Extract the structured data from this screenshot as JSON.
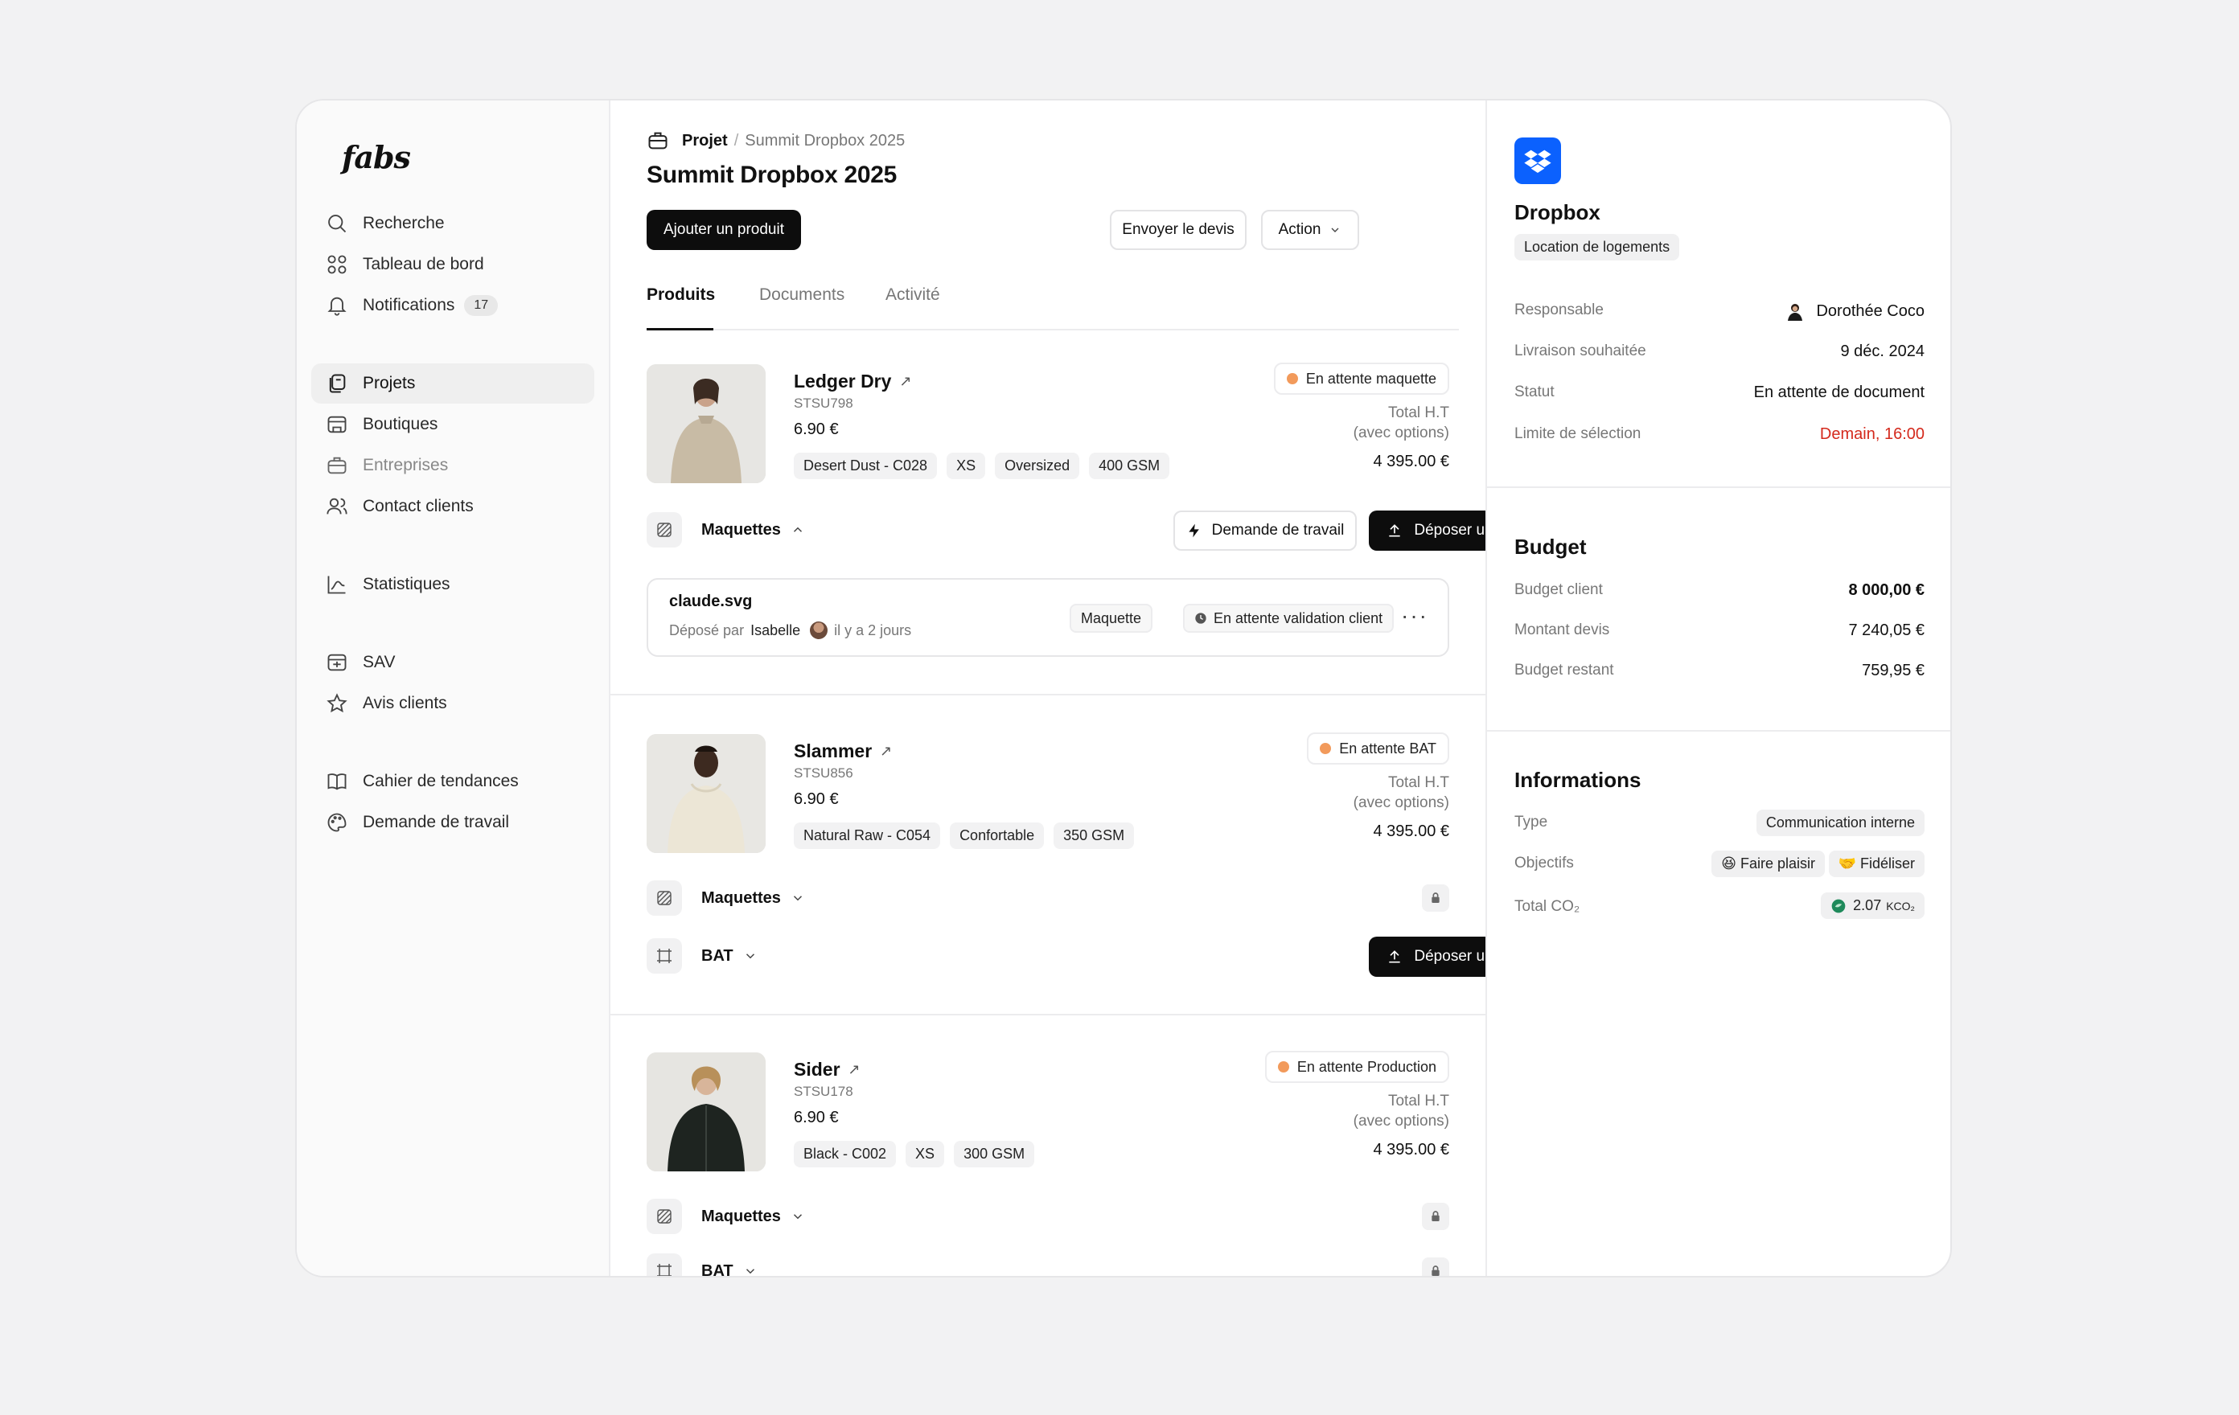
{
  "app": {
    "logo": "fabs"
  },
  "sidebar": {
    "group1": [
      {
        "label": "Recherche",
        "icon": "search-icon"
      },
      {
        "label": "Tableau de bord",
        "icon": "dashboard-icon"
      },
      {
        "label": "Notifications",
        "icon": "bell-icon",
        "badge": "17"
      }
    ],
    "group2": [
      {
        "label": "Projets",
        "icon": "projects-icon",
        "active": true
      },
      {
        "label": "Boutiques",
        "icon": "store-icon"
      },
      {
        "label": "Entreprises",
        "icon": "company-icon"
      },
      {
        "label": "Contact clients",
        "icon": "users-icon"
      }
    ],
    "group3": [
      {
        "label": "Statistiques",
        "icon": "chart-icon"
      }
    ],
    "group4": [
      {
        "label": "SAV",
        "icon": "sav-icon"
      },
      {
        "label": "Avis clients",
        "icon": "star-icon"
      }
    ],
    "group5": [
      {
        "label": "Cahier de tendances",
        "icon": "book-icon"
      },
      {
        "label": "Demande de travail",
        "icon": "palette-icon"
      }
    ]
  },
  "main": {
    "breadcrumb": {
      "root": "Projet",
      "separator": "/",
      "current": "Summit Dropbox 2025"
    },
    "title": "Summit Dropbox 2025",
    "actions": {
      "add_product": "Ajouter un produit",
      "send_quote": "Envoyer le devis",
      "action": "Action"
    },
    "tabs": [
      "Produits",
      "Documents",
      "Activité"
    ],
    "total_label_1": "Total H.T",
    "total_label_2": "(avec options)",
    "products": [
      {
        "name": "Ledger Dry",
        "ref": "STSU798",
        "price": "6.90 €",
        "chips": [
          "Desert Dust - C028",
          "XS",
          "Oversized",
          "400 GSM"
        ],
        "status": "En attente maquette",
        "total": "4 395.00 €",
        "maquettes_label": "Maquettes",
        "work_request": "Demande de travail",
        "upload": "Déposer un fichier",
        "file": {
          "name": "claude.svg",
          "deposited_by": "Déposé par",
          "user": "Isabelle",
          "when": "il y a 2 jours",
          "type": "Maquette",
          "status": "En attente validation client"
        }
      },
      {
        "name": "Slammer",
        "ref": "STSU856",
        "price": "6.90 €",
        "chips": [
          "Natural Raw - C054",
          "Confortable",
          "350 GSM"
        ],
        "status": "En attente BAT",
        "total": "4 395.00 €",
        "maquettes_label": "Maquettes",
        "bat_label": "BAT",
        "upload": "Déposer un fichier"
      },
      {
        "name": "Sider",
        "ref": "STSU178",
        "price": "6.90 €",
        "chips": [
          "Black - C002",
          "XS",
          "300 GSM"
        ],
        "status": "En attente Production",
        "total": "4 395.00 €",
        "maquettes_label": "Maquettes",
        "bat_label": "BAT"
      }
    ]
  },
  "right": {
    "company": "Dropbox",
    "category": "Location de logements",
    "details": [
      {
        "label": "Responsable",
        "value": "Dorothée Coco"
      },
      {
        "label": "Livraison souhaitée",
        "value": "9 déc. 2024"
      },
      {
        "label": "Statut",
        "value": "En attente de document"
      },
      {
        "label": "Limite de sélection",
        "value": "Demain, 16:00"
      }
    ],
    "budget": {
      "title": "Budget",
      "rows": [
        {
          "label": "Budget client",
          "value": "8 000,00 €"
        },
        {
          "label": "Montant devis",
          "value": "7 240,05 €"
        },
        {
          "label": "Budget restant",
          "value": "759,95 €"
        }
      ]
    },
    "info": {
      "title": "Informations",
      "type_label": "Type",
      "type_value": "Communication interne",
      "objectives_label": "Objectifs",
      "objective_1": "Faire plaisir",
      "objective_2": "Fidéliser",
      "co2_label": "Total CO₂",
      "co2_value": "2.07",
      "co2_unit": "KCO₂"
    }
  },
  "colors": {
    "accent_dark": "#0d0d0d",
    "status_dot": "#f29a5b",
    "danger": "#d4291c",
    "dropbox_blue": "#0b61fe",
    "co2_green": "#1f8a5b"
  }
}
